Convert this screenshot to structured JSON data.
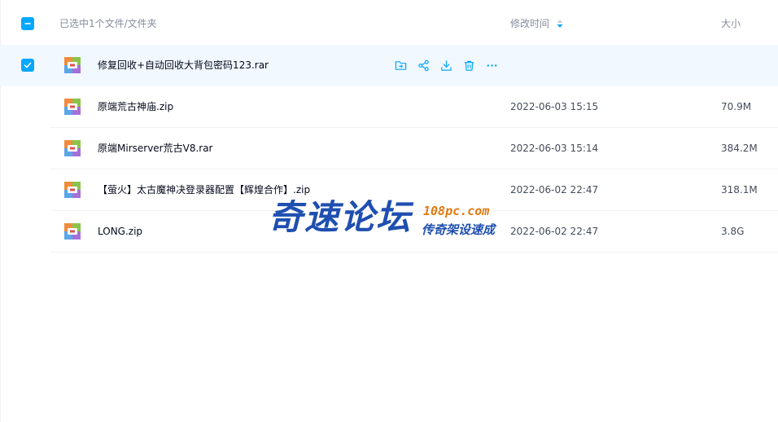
{
  "header": {
    "selection_text": "已选中1个文件/文件夹",
    "col_modified": "修改时间",
    "col_size": "大小"
  },
  "files": [
    {
      "name": "修复回收+自动回收大背包密码123.rar",
      "date": "",
      "size": "",
      "selected": true
    },
    {
      "name": "原端荒古神庙.zip",
      "date": "2022-06-03 15:15",
      "size": "70.9M",
      "selected": false
    },
    {
      "name": "原端Mirserver荒古V8.rar",
      "date": "2022-06-03 15:14",
      "size": "384.2M",
      "selected": false
    },
    {
      "name": "【萤火】太古魔神决登录器配置【辉煌合作】.zip",
      "date": "2022-06-02 22:47",
      "size": "318.1M",
      "selected": false
    },
    {
      "name": "LONG.zip",
      "date": "2022-06-02 22:47",
      "size": "3.8G",
      "selected": false
    }
  ],
  "row_actions": [
    "move-icon",
    "share-icon",
    "download-icon",
    "delete-icon",
    "more-icon"
  ],
  "watermark": {
    "main": "奇速论坛",
    "url": "108pc.com",
    "sub": "传奇架设速成"
  },
  "colors": {
    "accent": "#06a7ff",
    "selected_row": "#f2f8ff",
    "muted_text": "#878c9c"
  }
}
